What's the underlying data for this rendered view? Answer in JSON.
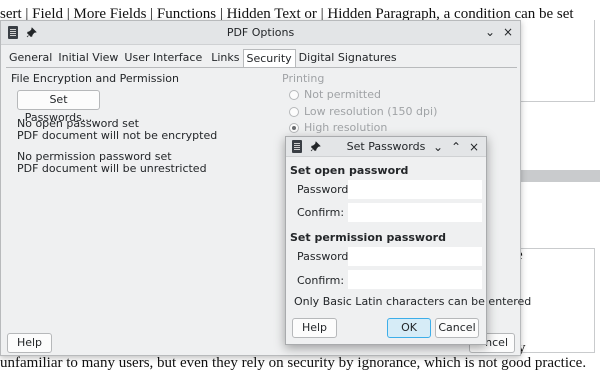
{
  "document": {
    "top_line": "sert | Field | More Fields | Functions | Hidden Text or | Hidden Paragraph, a condition can be set",
    "bottom_line": "unfamiliar to many users, but even they rely on security by ignorance, which is not good practice.",
    "right_fragment_1": "e",
    "right_fragment_2": "y"
  },
  "pdf_options": {
    "title": "PDF Options",
    "tabs": [
      {
        "label": "General"
      },
      {
        "label": "Initial View"
      },
      {
        "label": "User Interface"
      },
      {
        "label": "Links"
      },
      {
        "label": "Security"
      },
      {
        "label": "Digital Signatures"
      }
    ],
    "active_tab": "Security",
    "section_title": "File Encryption and Permission",
    "set_passwords_label": "Set Passwords...",
    "open_status": "No open password set",
    "open_detail": "PDF document will not be encrypted",
    "perm_status": "No permission password set",
    "perm_detail": "PDF document will be unrestricted",
    "printing": {
      "title": "Printing",
      "options": [
        {
          "label": "Not permitted",
          "checked": false
        },
        {
          "label": "Low resolution (150 dpi)",
          "checked": false
        },
        {
          "label": "High resolution",
          "checked": true
        }
      ]
    },
    "help_label": "Help",
    "cancel_label_partial": "ncel",
    "window_controls": {
      "minimize": "⌄",
      "close": "×"
    }
  },
  "set_passwords": {
    "title": "Set Passwords",
    "open_section": "Set open password",
    "perm_section": "Set permission password",
    "password_label": "Password:",
    "confirm_label": "Confirm:",
    "open_password_value": "",
    "open_confirm_value": "",
    "perm_password_value": "",
    "perm_confirm_value": "",
    "note": "Only Basic Latin characters can be entered",
    "help_label": "Help",
    "ok_label": "OK",
    "cancel_label": "Cancel",
    "window_controls": {
      "minimize": "⌄",
      "maximize": "⌃",
      "close": "×"
    }
  },
  "colors": {
    "accent": "#3daee9",
    "ok_bg": "#d6ecf7",
    "window_bg": "#eff0f1"
  }
}
